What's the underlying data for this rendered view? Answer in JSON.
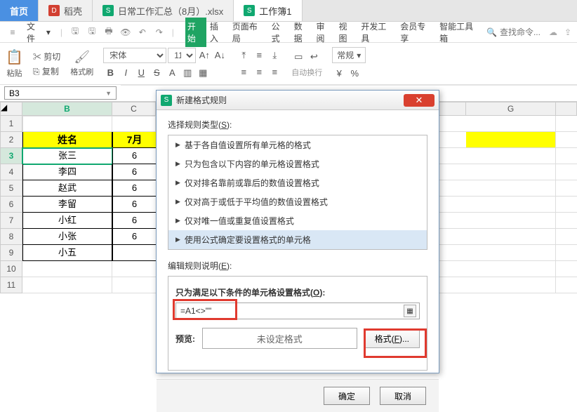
{
  "tabs": {
    "home": "首页",
    "daoke": "稻壳",
    "doc1": "日常工作汇总（8月）.xlsx",
    "doc2": "工作簿1"
  },
  "menubar": {
    "file": "文件",
    "items": [
      "开始",
      "插入",
      "页面布局",
      "公式",
      "数据",
      "审阅",
      "视图",
      "开发工具",
      "会员专享",
      "智能工具箱"
    ],
    "search_placeholder": "查找命令..."
  },
  "ribbon": {
    "cut": "剪切",
    "paste": "粘贴",
    "copy": "复制",
    "format_painter": "格式刷",
    "font": "宋体",
    "size": "11",
    "wrap": "自动换行",
    "styles": "常规",
    "currency": "¥"
  },
  "namebox": "B3",
  "sheet": {
    "cols": [
      "B",
      "C",
      "G"
    ],
    "header": {
      "B": "姓名",
      "C": "7月"
    },
    "rows": [
      {
        "n": 1,
        "B": "",
        "C": ""
      },
      {
        "n": 2,
        "B": "姓名",
        "C": "7月",
        "hdr": true
      },
      {
        "n": 3,
        "B": "张三",
        "C": "6"
      },
      {
        "n": 4,
        "B": "李四",
        "C": "6"
      },
      {
        "n": 5,
        "B": "赵武",
        "C": "6"
      },
      {
        "n": 6,
        "B": "李留",
        "C": "6"
      },
      {
        "n": 7,
        "B": "小红",
        "C": "6"
      },
      {
        "n": 8,
        "B": "小张",
        "C": "6"
      },
      {
        "n": 9,
        "B": "小五",
        "C": ""
      },
      {
        "n": 10,
        "B": "",
        "C": ""
      },
      {
        "n": 11,
        "B": "",
        "C": ""
      }
    ],
    "selected": "B3"
  },
  "dialog": {
    "title": "新建格式规则",
    "section_type": "选择规则类型",
    "section_type_key": "S",
    "rule_types": [
      "基于各自值设置所有单元格的格式",
      "只为包含以下内容的单元格设置格式",
      "仅对排名靠前或靠后的数值设置格式",
      "仅对高于或低于平均值的数值设置格式",
      "仅对唯一值或重复值设置格式",
      "使用公式确定要设置格式的单元格"
    ],
    "selected_rule_index": 5,
    "section_edit": "编辑规则说明",
    "section_edit_key": "E",
    "condition_label": "只为满足以下条件的单元格设置格式",
    "condition_key": "O",
    "formula": "=A1<>\"\"",
    "preview_label": "预览:",
    "preview_text": "未设定格式",
    "format_btn": "格式",
    "format_key": "F",
    "ok": "确定",
    "cancel": "取消"
  },
  "colon": ":",
  "ellipsis": "..."
}
